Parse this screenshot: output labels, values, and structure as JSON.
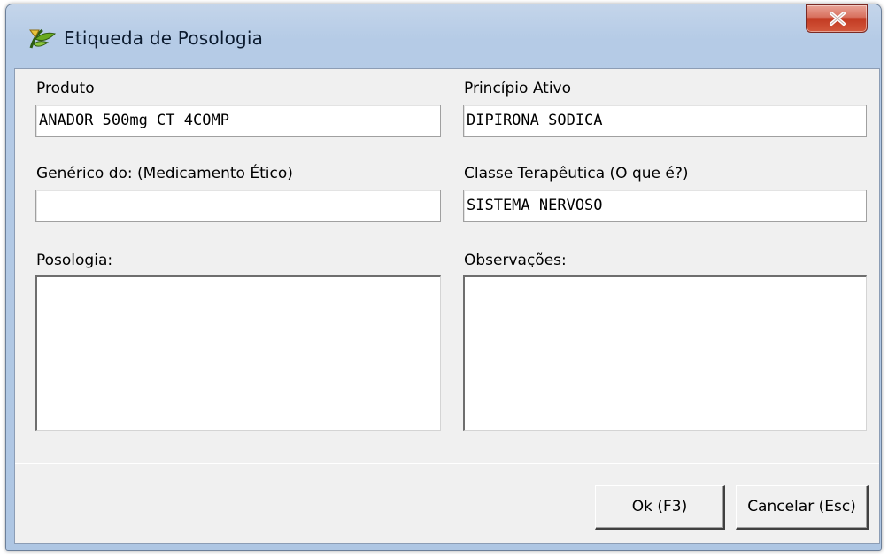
{
  "window": {
    "title": "Etiqueda de Posologia",
    "icon": "leaf-app-icon",
    "close_icon": "close-icon"
  },
  "form": {
    "produto": {
      "label": "Produto",
      "value": "ANADOR 500mg CT 4COMP"
    },
    "principio_ativo": {
      "label": "Princípio Ativo",
      "value": "DIPIRONA SODICA"
    },
    "generico": {
      "label": "Genérico do: (Medicamento Ético)",
      "value": ""
    },
    "classe_terapeutica": {
      "label": "Classe Terapêutica (O que é?)",
      "value": "SISTEMA NERVOSO"
    },
    "posologia": {
      "label": "Posologia:",
      "value": ""
    },
    "observacoes": {
      "label": "Observações:",
      "value": ""
    }
  },
  "buttons": {
    "ok": "Ok (F3)",
    "cancel": "Cancelar (Esc)"
  },
  "colors": {
    "client_bg": "#f0f0f0",
    "close_red": "#c23a22",
    "title_text": "#0b1a2e"
  }
}
